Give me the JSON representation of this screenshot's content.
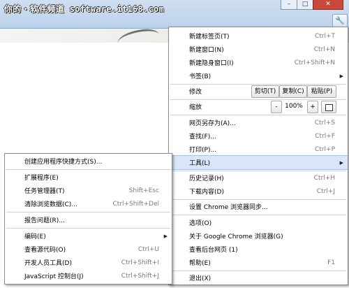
{
  "watermark": "你的・软件频道 software.it168.com",
  "window_controls": {
    "minimize": "–",
    "maximize": "□",
    "close": "✕"
  },
  "wrench_glyph": "🔧",
  "main_menu": {
    "new_tab": {
      "label": "新建标签页(T)",
      "shortcut": "Ctrl+T"
    },
    "new_window": {
      "label": "新建窗口(N)",
      "shortcut": "Ctrl+N"
    },
    "new_incognito": {
      "label": "新建隐身窗口(I)",
      "shortcut": "Ctrl+Shift+N"
    },
    "bookmarks": {
      "label": "书签(B)"
    },
    "edit": {
      "label": "修改",
      "cut": "剪切(T)",
      "copy": "复制(C)",
      "paste": "粘贴(P)"
    },
    "zoom": {
      "label": "缩放",
      "minus": "-",
      "value": "100%",
      "plus": "+"
    },
    "save_as": {
      "label": "网页另存为(A)...",
      "shortcut": "Ctrl+S"
    },
    "find": {
      "label": "查找(F)...",
      "shortcut": "Ctrl+F"
    },
    "print": {
      "label": "打印(P)...",
      "shortcut": "Ctrl+P"
    },
    "tools": {
      "label": "工具(L)"
    },
    "history": {
      "label": "历史记录(H)",
      "shortcut": "Ctrl+H"
    },
    "downloads": {
      "label": "下载内容(D)",
      "shortcut": "Ctrl+J"
    },
    "sync": {
      "label": "设置 Chrome 浏览器同步..."
    },
    "options": {
      "label": "选项(O)"
    },
    "about": {
      "label": "关于 Google Chrome 浏览器(G)"
    },
    "background_pages": {
      "label": "查看后台网页 (1)"
    },
    "help": {
      "label": "帮助(E)",
      "shortcut": "F1"
    },
    "exit": {
      "label": "退出(X)"
    }
  },
  "tools_submenu": {
    "create_shortcut": {
      "label": "创建应用程序快捷方式(S)..."
    },
    "extensions": {
      "label": "扩展程序(E)"
    },
    "task_manager": {
      "label": "任务管理器(T)",
      "shortcut": "Shift+Esc"
    },
    "clear_data": {
      "label": "清除浏览数据(C)...",
      "shortcut": "Ctrl+Shift+Del"
    },
    "report_issue": {
      "label": "报告问题(R)..."
    },
    "encoding": {
      "label": "编码(E)"
    },
    "view_source": {
      "label": "查看源代码(O)",
      "shortcut": "Ctrl+U"
    },
    "dev_tools": {
      "label": "开发人员工具(D)",
      "shortcut": "Ctrl+Shift+I"
    },
    "js_console": {
      "label": "JavaScript 控制台(J)",
      "shortcut": "Ctrl+Shift+J"
    }
  }
}
